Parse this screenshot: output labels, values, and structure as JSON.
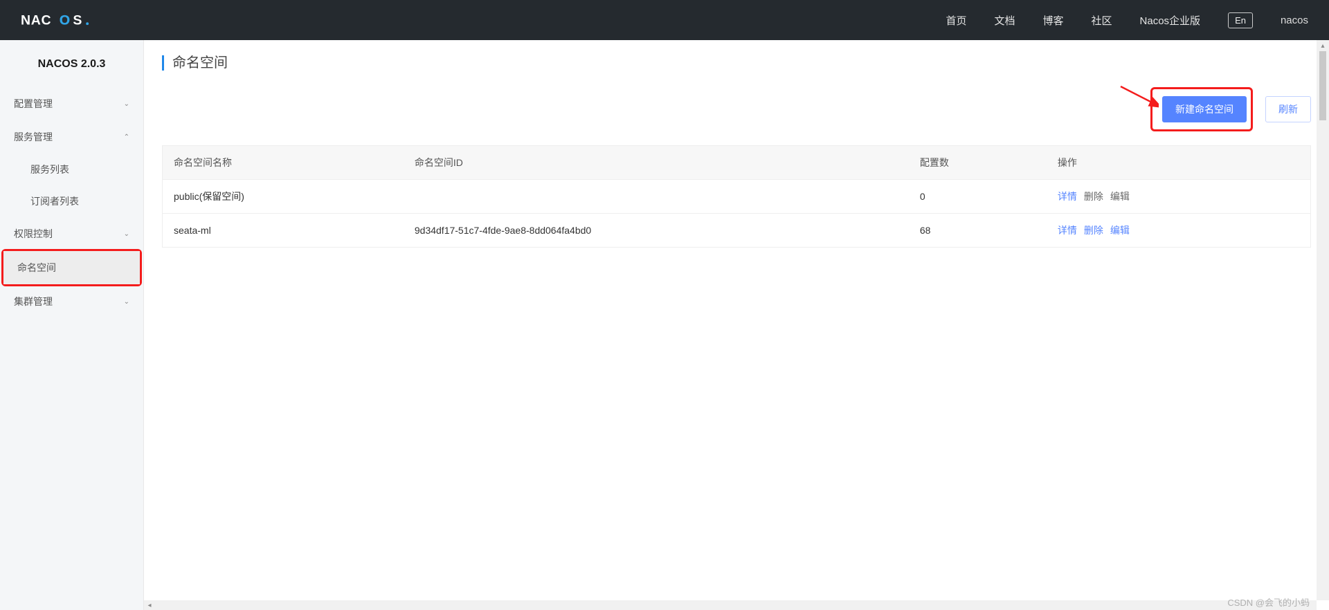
{
  "header": {
    "logo_text": "NACOS.",
    "nav": {
      "home": "首页",
      "docs": "文档",
      "blog": "博客",
      "community": "社区",
      "enterprise": "Nacos企业版"
    },
    "lang": "En",
    "user": "nacos"
  },
  "sidebar": {
    "version": "NACOS 2.0.3",
    "config_mgmt": "配置管理",
    "service_mgmt": "服务管理",
    "service_list": "服务列表",
    "subscriber_list": "订阅者列表",
    "access_control": "权限控制",
    "namespace": "命名空间",
    "cluster_mgmt": "集群管理"
  },
  "page": {
    "title": "命名空间",
    "create_btn": "新建命名空间",
    "refresh_btn": "刷新"
  },
  "table": {
    "headers": {
      "name": "命名空间名称",
      "id": "命名空间ID",
      "config_count": "配置数",
      "ops": "操作"
    },
    "rows": [
      {
        "name": "public(保留空间)",
        "id": "",
        "count": "0",
        "detail": "详情",
        "delete": "删除",
        "edit": "编辑",
        "detail_link": true,
        "delete_link": false,
        "edit_link": false
      },
      {
        "name": "seata-ml",
        "id": "9d34df17-51c7-4fde-9ae8-8dd064fa4bd0",
        "count": "68",
        "detail": "详情",
        "delete": "删除",
        "edit": "编辑",
        "detail_link": true,
        "delete_link": true,
        "edit_link": true
      }
    ]
  },
  "watermark": "CSDN @会飞的小蚂"
}
